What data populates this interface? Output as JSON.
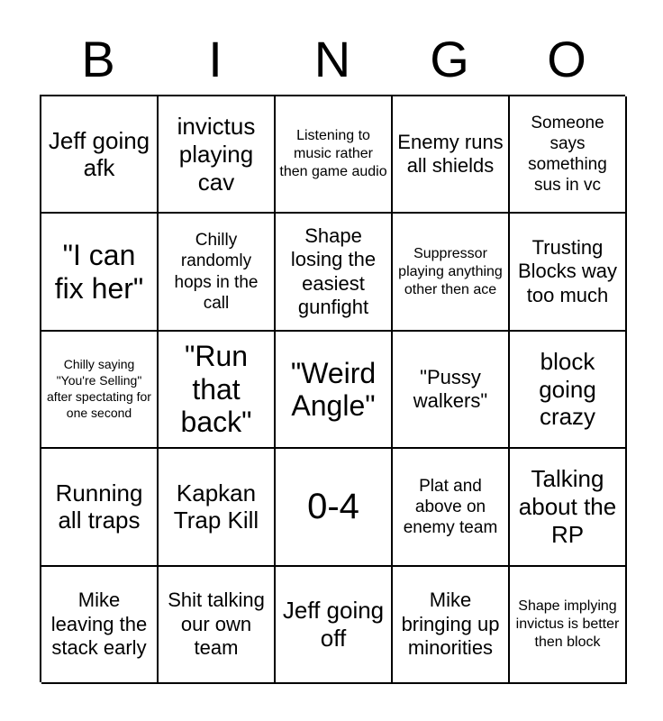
{
  "card": {
    "title_letters": [
      "B",
      "I",
      "N",
      "G",
      "O"
    ],
    "grid_size": 5,
    "text_color": "#000000",
    "border_color": "#000000",
    "background_color": "#ffffff",
    "rows": [
      [
        {
          "text": "Jeff going afk",
          "size": "lg"
        },
        {
          "text": "invictus playing cav",
          "size": "lg"
        },
        {
          "text": "Listening to music rather then game audio",
          "size": "xs"
        },
        {
          "text": "Enemy runs all shields",
          "size": "md"
        },
        {
          "text": "Someone says something sus in vc",
          "size": "sm"
        }
      ],
      [
        {
          "text": "\"I can fix her\"",
          "size": "xl"
        },
        {
          "text": "Chilly randomly hops in the call",
          "size": "sm"
        },
        {
          "text": "Shape losing the easiest gunfight",
          "size": "md"
        },
        {
          "text": "Suppressor playing anything other then ace",
          "size": "xs"
        },
        {
          "text": "Trusting Blocks way too much",
          "size": "md"
        }
      ],
      [
        {
          "text": "Chilly saying \"You're Selling\" after spectating for one second",
          "size": "xxs"
        },
        {
          "text": "\"Run that back\"",
          "size": "xl"
        },
        {
          "text": "\"Weird Angle\"",
          "size": "xl"
        },
        {
          "text": "\"Pussy walkers\"",
          "size": "md"
        },
        {
          "text": "block going crazy",
          "size": "lg"
        }
      ],
      [
        {
          "text": "Running all traps",
          "size": "lg"
        },
        {
          "text": "Kapkan Trap Kill",
          "size": "lg"
        },
        {
          "text": "0-4",
          "size": "xxl"
        },
        {
          "text": "Plat and above on enemy team",
          "size": "sm"
        },
        {
          "text": "Talking about the RP",
          "size": "lg"
        }
      ],
      [
        {
          "text": "Mike leaving the stack early",
          "size": "md"
        },
        {
          "text": "Shit talking our own team",
          "size": "md"
        },
        {
          "text": "Jeff going off",
          "size": "lg"
        },
        {
          "text": "Mike bringing up minorities",
          "size": "md"
        },
        {
          "text": "Shape implying invictus is better then block",
          "size": "xs"
        }
      ]
    ]
  }
}
